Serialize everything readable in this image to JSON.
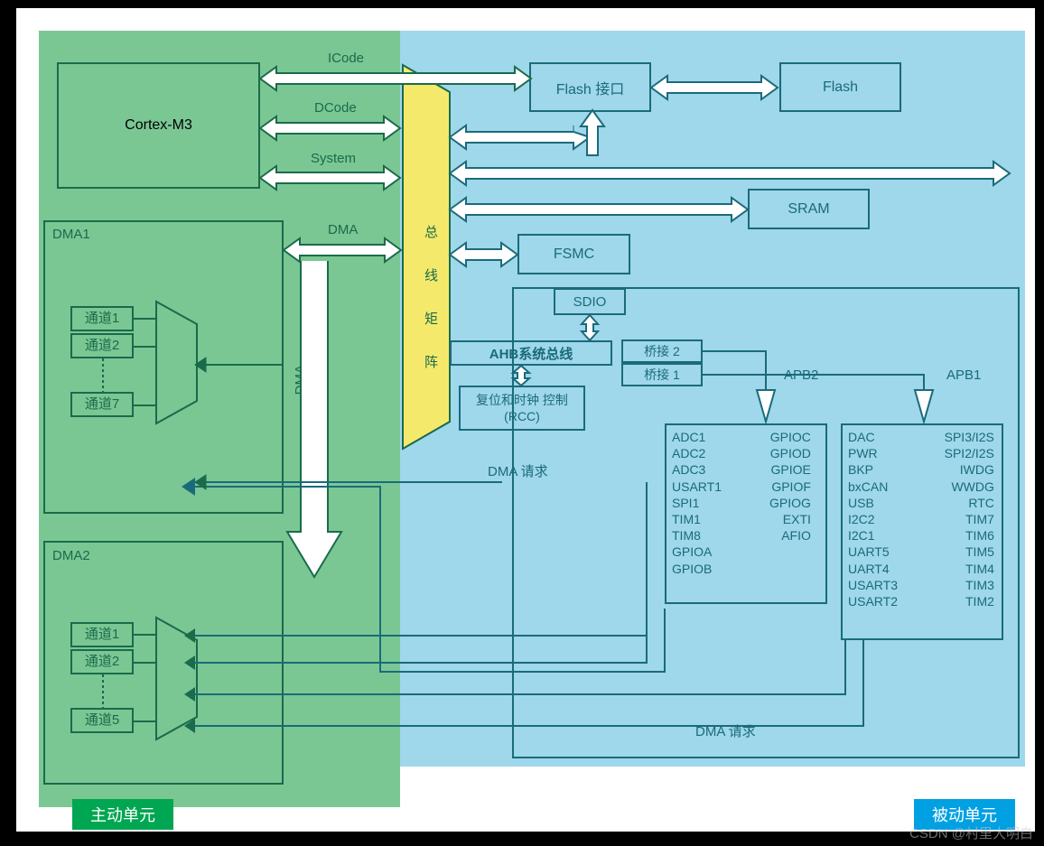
{
  "cortex": "Cortex-M3",
  "buses": {
    "icode": "ICode",
    "dcode": "DCode",
    "system": "System",
    "dma": "DMA"
  },
  "matrix": "总 线 矩 阵",
  "dma_vert": "DMA",
  "blocks": {
    "flash_if": "Flash 接口",
    "flash": "Flash",
    "sram": "SRAM",
    "fsmc": "FSMC",
    "sdio": "SDIO",
    "ahb": "AHB系统总线",
    "bridge2": "桥接 2",
    "bridge1": "桥接 1",
    "rcc": "复位和时钟 控制 (RCC)",
    "apb2": "APB2",
    "apb1": "APB1"
  },
  "dma1": {
    "title": "DMA1",
    "channels": [
      "通道1",
      "通道2",
      "通道7"
    ]
  },
  "dma2": {
    "title": "DMA2",
    "channels": [
      "通道1",
      "通道2",
      "通道5"
    ]
  },
  "dma_request": "DMA 请求",
  "apb2_list_l": [
    "ADC1",
    "ADC2",
    "ADC3",
    "USART1",
    "SPI1",
    "TIM1",
    "TIM8",
    "GPIOA",
    "GPIOB"
  ],
  "apb2_list_r": [
    "GPIOC",
    "GPIOD",
    "GPIOE",
    "GPIOF",
    "GPIOG",
    "EXTI",
    "AFIO"
  ],
  "apb1_list_l": [
    "DAC",
    "PWR",
    "BKP",
    "bxCAN",
    "USB",
    "I2C2",
    "I2C1",
    "UART5",
    "UART4",
    "USART3",
    "USART2"
  ],
  "apb1_list_r": [
    "SPI3/I2S",
    "SPI2/I2S",
    "IWDG",
    "WWDG",
    "RTC",
    "TIM7",
    "TIM6",
    "TIM5",
    "TIM4",
    "TIM3",
    "TIM2"
  ],
  "footer": {
    "active": "主动单元",
    "passive": "被动单元"
  },
  "watermark": "CSDN @村里大明白",
  "colors": {
    "green": "#7ac794",
    "blue": "#9fd7eb",
    "yellow": "#f5e96c",
    "darkgreen": "#1a6b4a",
    "darkblue": "#1a6b7a",
    "footer_green": "#00a651",
    "footer_blue": "#00a0e3"
  }
}
